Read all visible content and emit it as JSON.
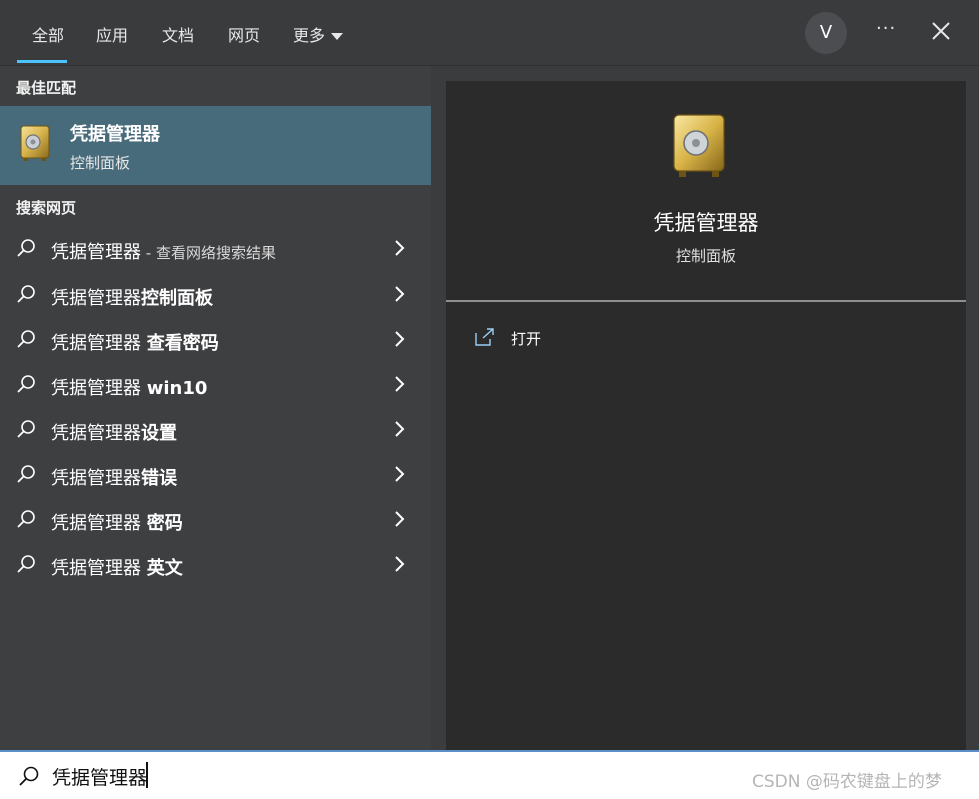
{
  "tabs": [
    {
      "label": "全部",
      "active": true
    },
    {
      "label": "应用"
    },
    {
      "label": "文档"
    },
    {
      "label": "网页"
    },
    {
      "label": "更多"
    }
  ],
  "account": {
    "avatar_letter": "V"
  },
  "toolbar": {
    "more_options": "···"
  },
  "best_match": {
    "section_title": "最佳匹配",
    "name": "凭据管理器",
    "subtitle": "控制面板",
    "icon": "safe-icon"
  },
  "web_search": {
    "section_title": "搜索网页",
    "items": [
      {
        "prefix": "凭据管理器",
        "suffix": "",
        "hint": " - 查看网络搜索结果"
      },
      {
        "prefix": "凭据管理器",
        "suffix": "控制面板",
        "hint": ""
      },
      {
        "prefix": "凭据管理器 ",
        "suffix": "查看密码",
        "hint": ""
      },
      {
        "prefix": "凭据管理器 ",
        "suffix": "win10",
        "hint": ""
      },
      {
        "prefix": "凭据管理器",
        "suffix": "设置",
        "hint": ""
      },
      {
        "prefix": "凭据管理器",
        "suffix": "错误",
        "hint": ""
      },
      {
        "prefix": "凭据管理器 ",
        "suffix": "密码",
        "hint": ""
      },
      {
        "prefix": "凭据管理器 ",
        "suffix": "英文",
        "hint": ""
      }
    ]
  },
  "preview": {
    "name": "凭据管理器",
    "subtitle": "控制面板",
    "actions": [
      {
        "label": "打开",
        "icon": "open-external-icon"
      }
    ]
  },
  "search": {
    "query": "凭据管理器"
  },
  "watermark": "CSDN @码农键盘上的梦",
  "colors": {
    "accent": "#4cc2ff",
    "selected_bg": "#486b7c"
  }
}
